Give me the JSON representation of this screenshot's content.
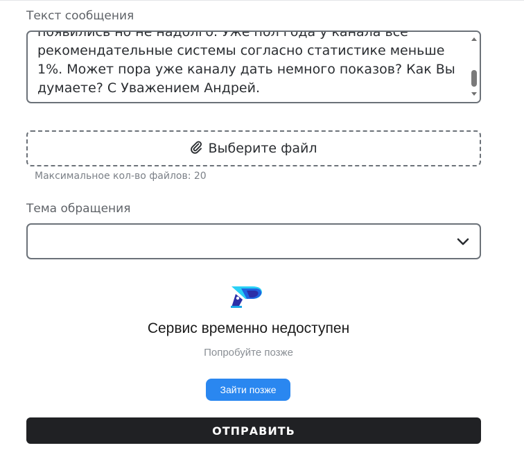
{
  "message": {
    "label": "Текст сообщения",
    "value": "появились но не надолго. Уже пол года у канала все рекомендательные системы согласно статистике меньше 1%. Может пора уже каналу дать немного показов? Как Вы думаете? С Уважением Андрей."
  },
  "attachment": {
    "button_label": "Выберите файл",
    "icon": "paperclip-icon",
    "hint": "Максимальное кол-во файлов: 20"
  },
  "topic": {
    "label": "Тема обращения",
    "selected_value": "",
    "icon": "chevron-down-icon"
  },
  "service_notice": {
    "icon": "service-logo-icon",
    "title": "Сервис временно недоступен",
    "subtitle": "Попробуйте позже",
    "button_label": "Зайти позже",
    "button_color": "#2a87f0"
  },
  "submit": {
    "label": "ОТПРАВИТЬ",
    "color": "#202124"
  }
}
